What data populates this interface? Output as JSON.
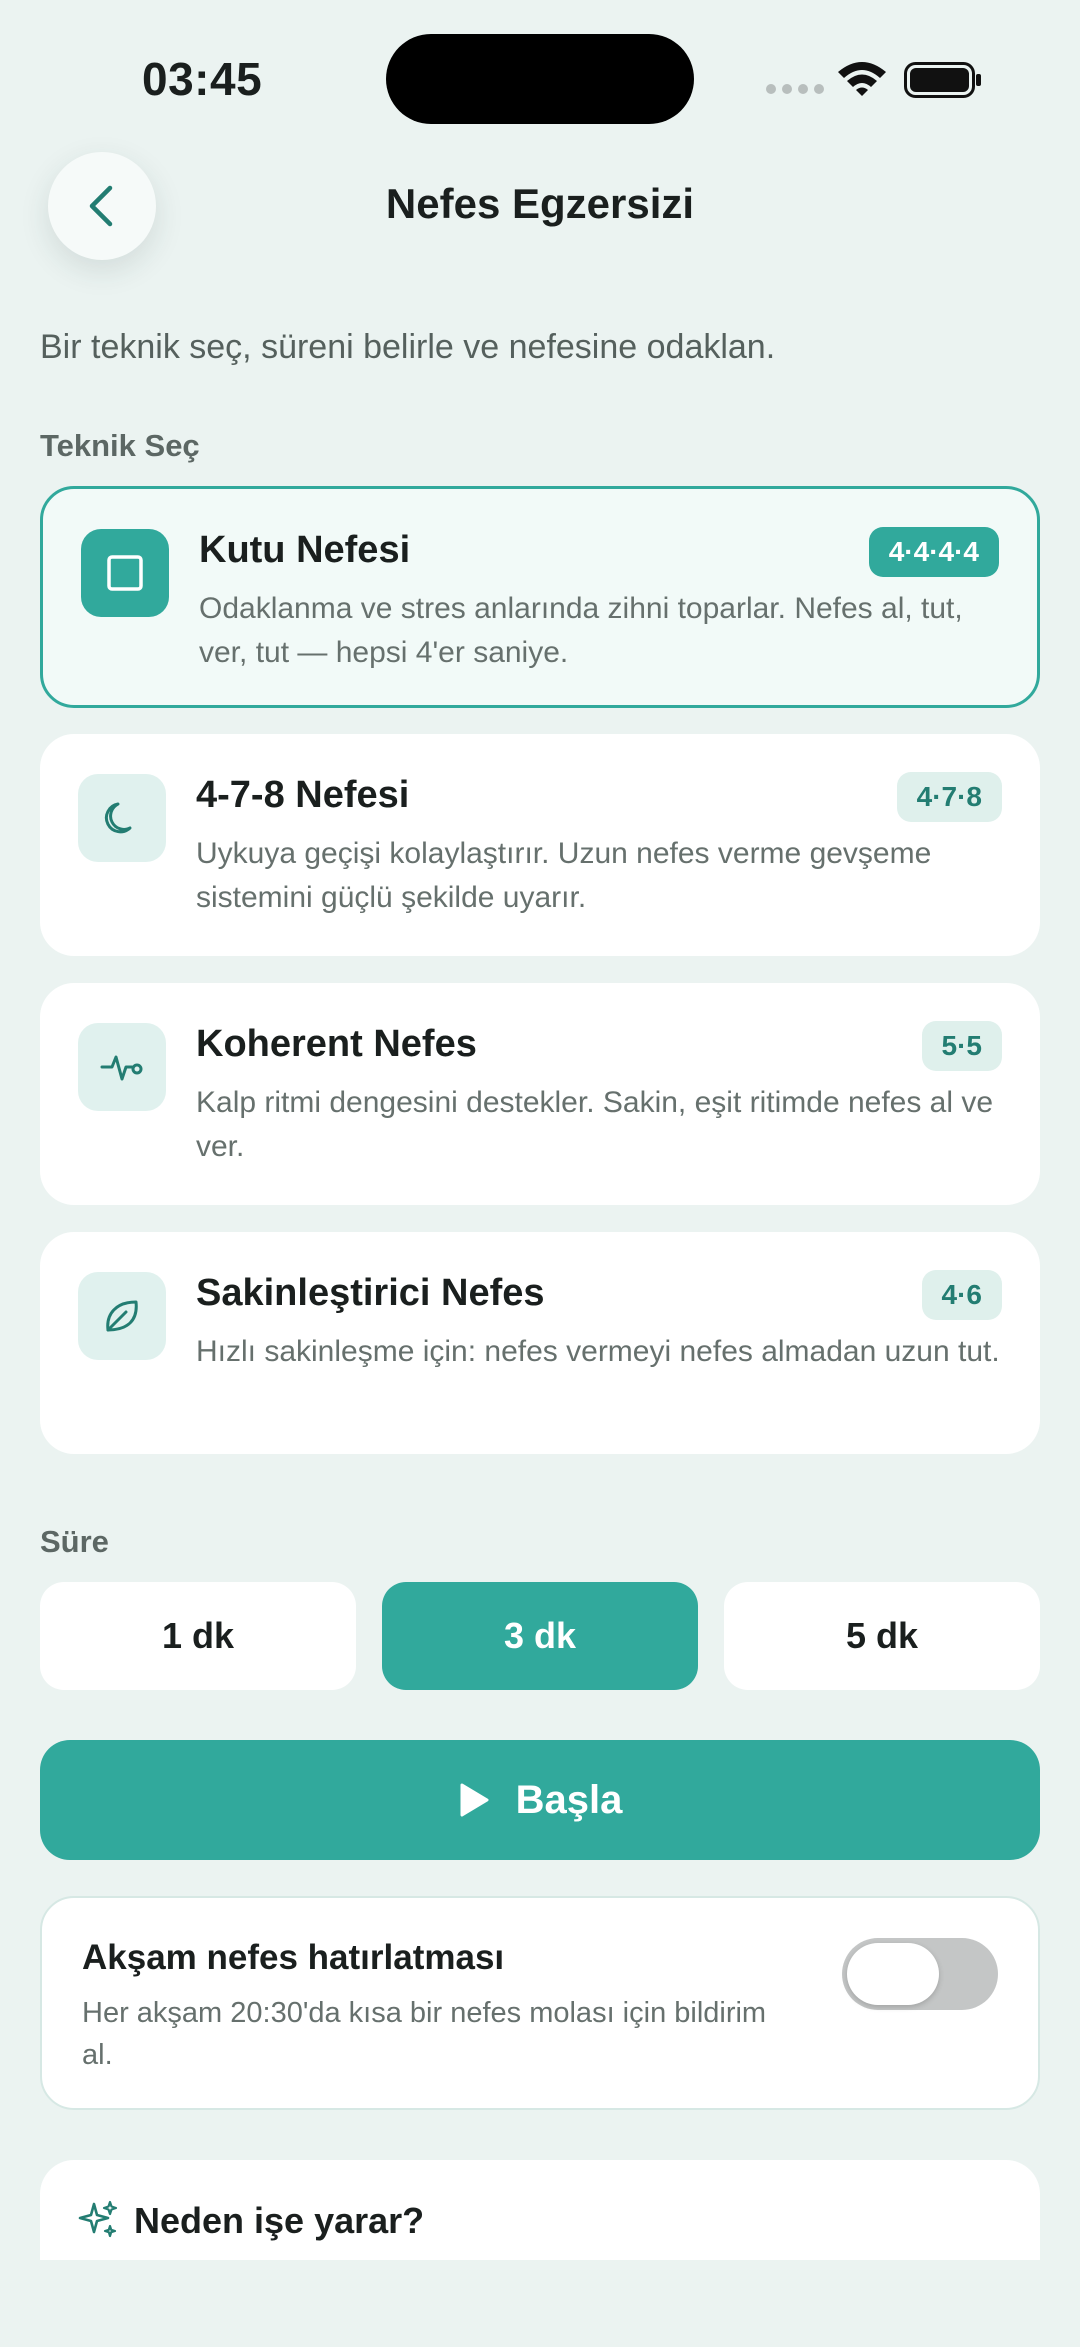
{
  "status_bar": {
    "time": "03:45"
  },
  "header": {
    "title": "Nefes Egzersizi"
  },
  "intro": "Bir teknik seç, süreni belirle ve nefesine odaklan.",
  "technique_section": {
    "label": "Teknik Seç",
    "cards": [
      {
        "title": "Kutu Nefesi",
        "badge": "4·4·4·4",
        "desc": "Odaklanma ve stres anlarında zihni toparlar. Nefes al, tut, ver, tut — hepsi 4'er saniye.",
        "icon": "square-icon",
        "selected": true
      },
      {
        "title": "4-7-8 Nefesi",
        "badge": "4·7·8",
        "desc": "Uykuya geçişi kolaylaştırır. Uzun nefes verme gevşeme sistemini güçlü şekilde uyarır.",
        "icon": "moon-icon",
        "selected": false
      },
      {
        "title": "Koherent Nefes",
        "badge": "5·5",
        "desc": "Kalp ritmi dengesini destekler. Sakin, eşit ritimde nefes al ve ver.",
        "icon": "heartbeat-icon",
        "selected": false
      },
      {
        "title": "Sakinleştirici Nefes",
        "badge": "4·6",
        "desc": "Hızlı sakinleşme için: nefes vermeyi nefes almadan uzun tut.",
        "icon": "leaf-icon",
        "selected": false
      }
    ]
  },
  "duration_section": {
    "label": "Süre",
    "options": [
      "1 dk",
      "3 dk",
      "5 dk"
    ],
    "selected": "3 dk"
  },
  "start_button": {
    "label": "Başla"
  },
  "reminder": {
    "title": "Akşam nefes hatırlatması",
    "desc": "Her akşam 20:30'da kısa bir nefes molası için bildirim al.",
    "enabled": false
  },
  "why_section": {
    "title": "Neden işe yarar?"
  },
  "colors": {
    "accent": "#31a99c",
    "background": "#ebf3f1",
    "toggle_off": "#c4c6c6"
  }
}
